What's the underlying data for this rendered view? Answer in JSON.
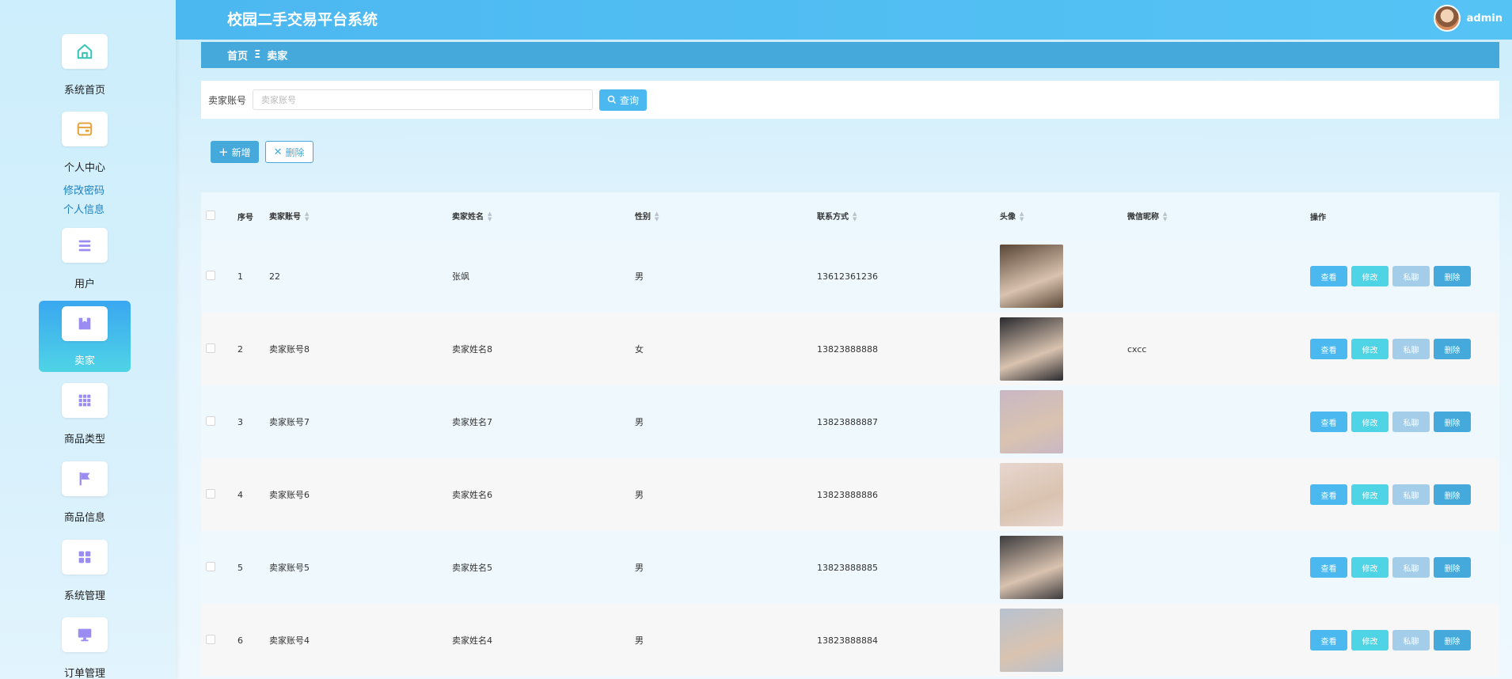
{
  "app": {
    "title": "校园二手交易平台系统",
    "username": "admin"
  },
  "sidebar": {
    "items": [
      {
        "label": "系统首页",
        "icon": "home-icon"
      },
      {
        "label": "个人中心",
        "icon": "card-icon"
      },
      {
        "label": "用户",
        "icon": "list-icon"
      },
      {
        "label": "卖家",
        "icon": "box-icon",
        "active": true
      },
      {
        "label": "商品类型",
        "icon": "grid-icon"
      },
      {
        "label": "商品信息",
        "icon": "flag-icon"
      },
      {
        "label": "系统管理",
        "icon": "apps-icon"
      },
      {
        "label": "订单管理",
        "icon": "monitor-icon"
      }
    ],
    "submenu": [
      "修改密码",
      "个人信息"
    ]
  },
  "breadcrumb": {
    "home": "首页",
    "separator": "Ξ",
    "current": "卖家"
  },
  "search": {
    "label": "卖家账号",
    "placeholder": "卖家账号",
    "value": "",
    "button": "查询"
  },
  "actions": {
    "add": "新增",
    "delete": "删除"
  },
  "table": {
    "headers": [
      "序号",
      "卖家账号",
      "卖家姓名",
      "性别",
      "联系方式",
      "头像",
      "微信昵称",
      "操作"
    ],
    "rows": [
      {
        "no": "1",
        "account": "22",
        "name": "张飒",
        "gender": "男",
        "phone": "13612361236",
        "wechat": "",
        "avatar_color": "#5a4636"
      },
      {
        "no": "2",
        "account": "卖家账号8",
        "name": "卖家姓名8",
        "gender": "女",
        "phone": "13823888888",
        "wechat": "cxcc",
        "avatar_color": "#2a2a2e"
      },
      {
        "no": "3",
        "account": "卖家账号7",
        "name": "卖家姓名7",
        "gender": "男",
        "phone": "13823888887",
        "wechat": "",
        "avatar_color": "#c9b7c4"
      },
      {
        "no": "4",
        "account": "卖家账号6",
        "name": "卖家姓名6",
        "gender": "男",
        "phone": "13823888886",
        "wechat": "",
        "avatar_color": "#e8d6cf"
      },
      {
        "no": "5",
        "account": "卖家账号5",
        "name": "卖家姓名5",
        "gender": "男",
        "phone": "13823888885",
        "wechat": "",
        "avatar_color": "#3d3b3d"
      },
      {
        "no": "6",
        "account": "卖家账号4",
        "name": "卖家姓名4",
        "gender": "男",
        "phone": "13823888884",
        "wechat": "",
        "avatar_color": "#b8c2cf"
      }
    ],
    "ops": {
      "view": "查看",
      "edit": "修改",
      "chat": "私聊",
      "delete": "删除"
    }
  },
  "colors": {
    "primary": "#4cb8f0",
    "accent": "#4fd4e6",
    "dark": "#46a9db"
  }
}
